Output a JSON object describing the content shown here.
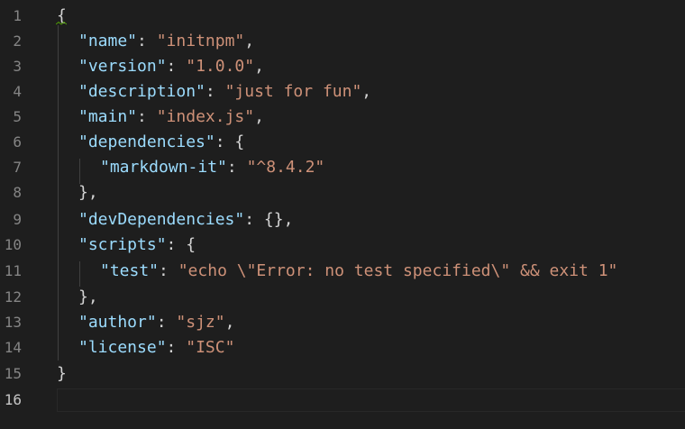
{
  "editor": {
    "line_numbers": [
      "1",
      "2",
      "3",
      "4",
      "5",
      "6",
      "7",
      "8",
      "9",
      "10",
      "11",
      "12",
      "13",
      "14",
      "15",
      "16"
    ],
    "active_line": "16",
    "lines": {
      "l1": {
        "open": "{"
      },
      "l2": {
        "key": "\"name\"",
        "sep": ": ",
        "val": "\"initnpm\"",
        "end": ","
      },
      "l3": {
        "key": "\"version\"",
        "sep": ": ",
        "val": "\"1.0.0\"",
        "end": ","
      },
      "l4": {
        "key": "\"description\"",
        "sep": ": ",
        "val": "\"just for fun\"",
        "end": ","
      },
      "l5": {
        "key": "\"main\"",
        "sep": ": ",
        "val": "\"index.js\"",
        "end": ","
      },
      "l6": {
        "key": "\"dependencies\"",
        "sep": ": ",
        "open": "{"
      },
      "l7": {
        "key": "\"markdown-it\"",
        "sep": ": ",
        "val": "\"^8.4.2\""
      },
      "l8": {
        "close": "},"
      },
      "l9": {
        "key": "\"devDependencies\"",
        "sep": ": ",
        "rest": "{},"
      },
      "l10": {
        "key": "\"scripts\"",
        "sep": ": ",
        "open": "{"
      },
      "l11": {
        "key": "\"test\"",
        "sep": ": ",
        "val": "\"echo \\\"Error: no test specified\\\" && exit 1\""
      },
      "l12": {
        "close": "},"
      },
      "l13": {
        "key": "\"author\"",
        "sep": ": ",
        "val": "\"sjz\"",
        "end": ","
      },
      "l14": {
        "key": "\"license\"",
        "sep": ": ",
        "val": "\"ISC\""
      },
      "l15": {
        "close": "}"
      },
      "l16": {}
    }
  },
  "colors": {
    "background": "#1e1e1e",
    "line_number": "#858585",
    "active_line_number": "#c6c6c6",
    "json_key": "#9cdcfe",
    "json_string": "#ce9178",
    "punctuation": "#d4d4d4",
    "indent_guide": "#404040",
    "warning_squiggle": "#4e9a06"
  }
}
